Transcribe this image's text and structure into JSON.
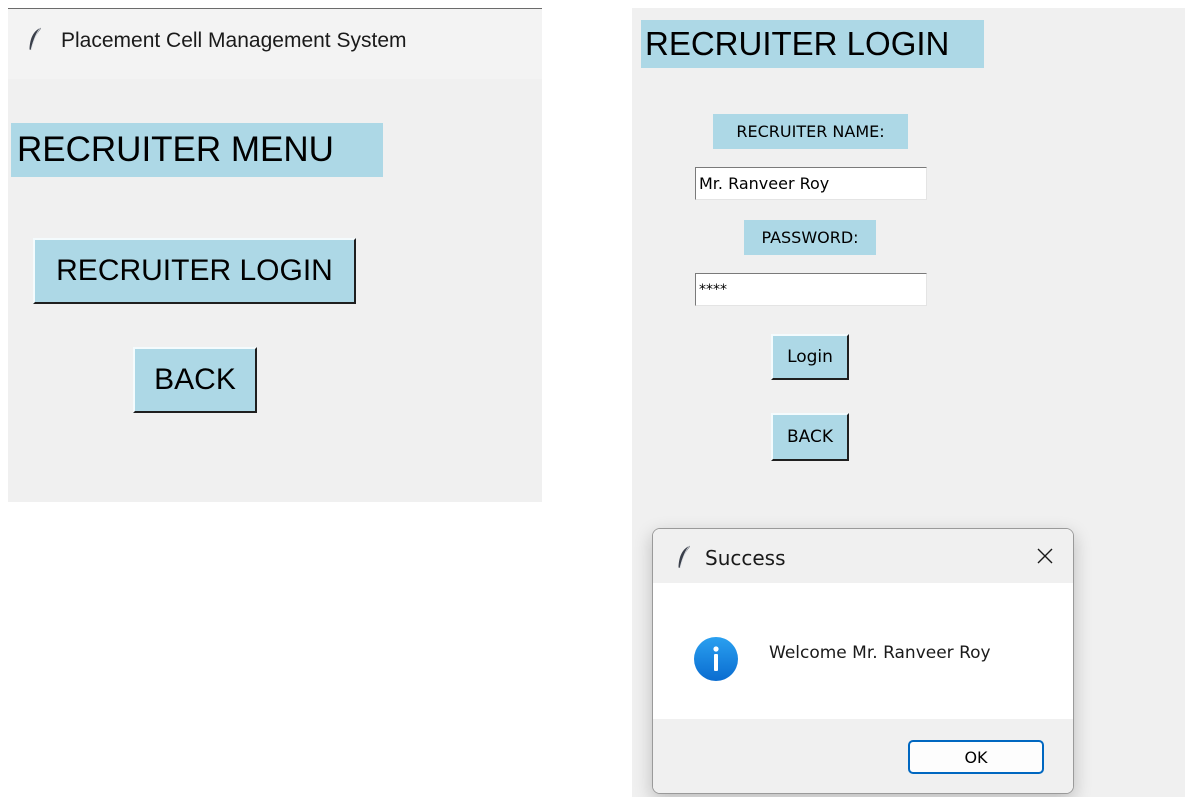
{
  "left_window": {
    "title": "Placement Cell Management System",
    "heading": "RECRUITER MENU",
    "recruiter_login_label": "RECRUITER LOGIN",
    "back_label": "BACK"
  },
  "right_window": {
    "heading": "RECRUITER LOGIN",
    "name_label": "RECRUITER NAME:",
    "name_value": "Mr. Ranveer Roy",
    "password_label": "PASSWORD:",
    "password_value": "****",
    "login_label": "Login",
    "back_label": "BACK"
  },
  "dialog": {
    "title": "Success",
    "message": "Welcome Mr. Ranveer Roy",
    "ok_label": "OK",
    "icon": "info-icon",
    "close_icon": "close-icon"
  },
  "colors": {
    "widget_bg": "#add8e6",
    "window_bg": "#f0f0f0",
    "accent": "#0067c0"
  }
}
